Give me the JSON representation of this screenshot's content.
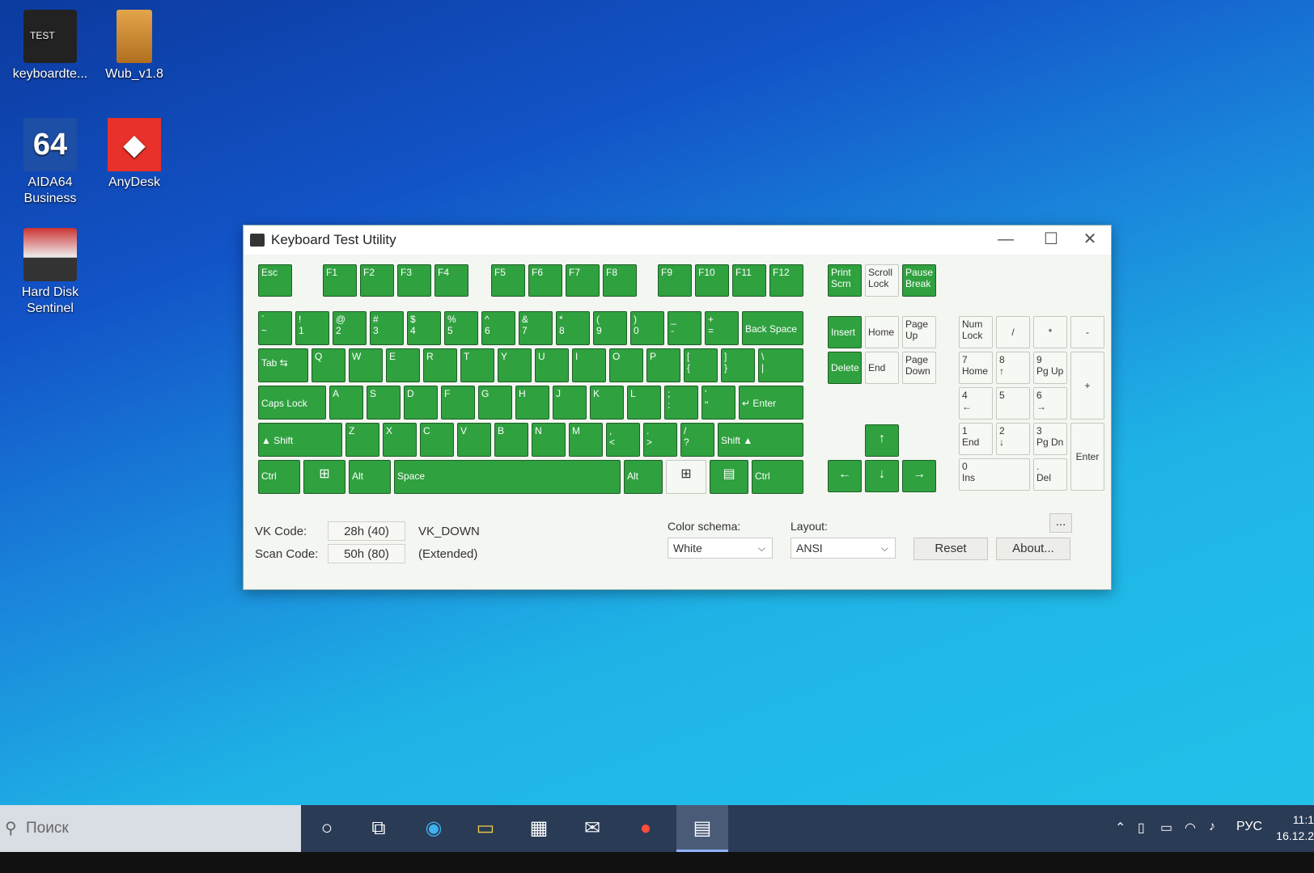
{
  "desktop": {
    "icons": [
      {
        "label": "keyboardte..."
      },
      {
        "label": "Wub_v1.8"
      },
      {
        "label": "AIDA64 Business"
      },
      {
        "label": "AnyDesk"
      },
      {
        "label": "Hard Disk Sentinel"
      }
    ],
    "kbtest_icon_text": "TEST",
    "aida_icon_text": "64"
  },
  "window": {
    "title": "Keyboard Test Utility",
    "minimize": "—",
    "maximize": "☐",
    "close": "✕"
  },
  "keys": {
    "esc": "Esc",
    "f": [
      "F1",
      "F2",
      "F3",
      "F4",
      "F5",
      "F6",
      "F7",
      "F8",
      "F9",
      "F10",
      "F11",
      "F12"
    ],
    "print": [
      "Print",
      "Scrn"
    ],
    "scroll": [
      "Scroll",
      "Lock"
    ],
    "pause": [
      "Pause",
      "Break"
    ],
    "number_row": [
      [
        "`",
        "~"
      ],
      [
        "!",
        "1"
      ],
      [
        "@",
        "2"
      ],
      [
        "#",
        "3"
      ],
      [
        "$",
        "4"
      ],
      [
        "%",
        "5"
      ],
      [
        "^",
        "6"
      ],
      [
        "&",
        "7"
      ],
      [
        "*",
        "8"
      ],
      [
        "(",
        "9"
      ],
      [
        ")",
        "0"
      ],
      [
        "_",
        "-"
      ],
      [
        "+",
        "="
      ]
    ],
    "backspace": "Back Space",
    "tab": "Tab ⇆",
    "qwerty": [
      "Q",
      "W",
      "E",
      "R",
      "T",
      "Y",
      "U",
      "I",
      "O",
      "P"
    ],
    "bracket_l": [
      "[",
      "{"
    ],
    "bracket_r": [
      "]",
      "}"
    ],
    "backslash": [
      "\\",
      "|"
    ],
    "caps": "Caps Lock",
    "asdf": [
      "A",
      "S",
      "D",
      "F",
      "G",
      "H",
      "J",
      "K",
      "L"
    ],
    "semicolon": [
      ";",
      ":"
    ],
    "quote": [
      "'",
      "\""
    ],
    "enter": "↵ Enter",
    "shift_l": "▲  Shift",
    "zxcv": [
      "Z",
      "X",
      "C",
      "V",
      "B",
      "N",
      "M"
    ],
    "comma": [
      ",",
      "<"
    ],
    "period": [
      ".",
      ">"
    ],
    "slash": [
      "/",
      "?"
    ],
    "shift_r": "Shift  ▲",
    "ctrl": "Ctrl",
    "win": "⊞",
    "alt": "Alt",
    "space": "Space",
    "menu": "▤",
    "insert": "Insert",
    "home": "Home",
    "pgup": [
      "Page",
      "Up"
    ],
    "delete": "Delete",
    "end": "End",
    "pgdn": [
      "Page",
      "Down"
    ],
    "up": "↑",
    "left": "←",
    "down": "↓",
    "right": "→",
    "numlock": [
      "Num",
      "Lock"
    ],
    "np_div": "/",
    "np_mul": "*",
    "np_minus": "-",
    "np7": [
      "7",
      "Home"
    ],
    "np8": [
      "8",
      "↑"
    ],
    "np9": [
      "9",
      "Pg Up"
    ],
    "np_plus": "+",
    "np4": [
      "4",
      "←"
    ],
    "np5": [
      "5"
    ],
    "np6": [
      "6",
      "→"
    ],
    "np1": [
      "1",
      "End"
    ],
    "np2": [
      "2",
      "↓"
    ],
    "np3": [
      "3",
      "Pg Dn"
    ],
    "np_enter": "Enter",
    "np0": [
      "0",
      "Ins"
    ],
    "np_dot": [
      ".",
      "Del"
    ]
  },
  "info": {
    "vk_label": "VK Code:",
    "vk_value": "28h (40)",
    "vk_name": "VK_DOWN",
    "scan_label": "Scan Code:",
    "scan_value": "50h (80)",
    "scan_ext": "(Extended)",
    "color_label": "Color schema:",
    "color_value": "White",
    "layout_label": "Layout:",
    "layout_value": "ANSI",
    "more_btn": "...",
    "reset_btn": "Reset",
    "about_btn": "About..."
  },
  "taskbar": {
    "search_placeholder": "Поиск",
    "lang": "РУС",
    "time": "11:1",
    "date": "16.12.2"
  },
  "colors": {
    "key_active": "#2fa13f",
    "key_idle": "#f6f8f4"
  }
}
